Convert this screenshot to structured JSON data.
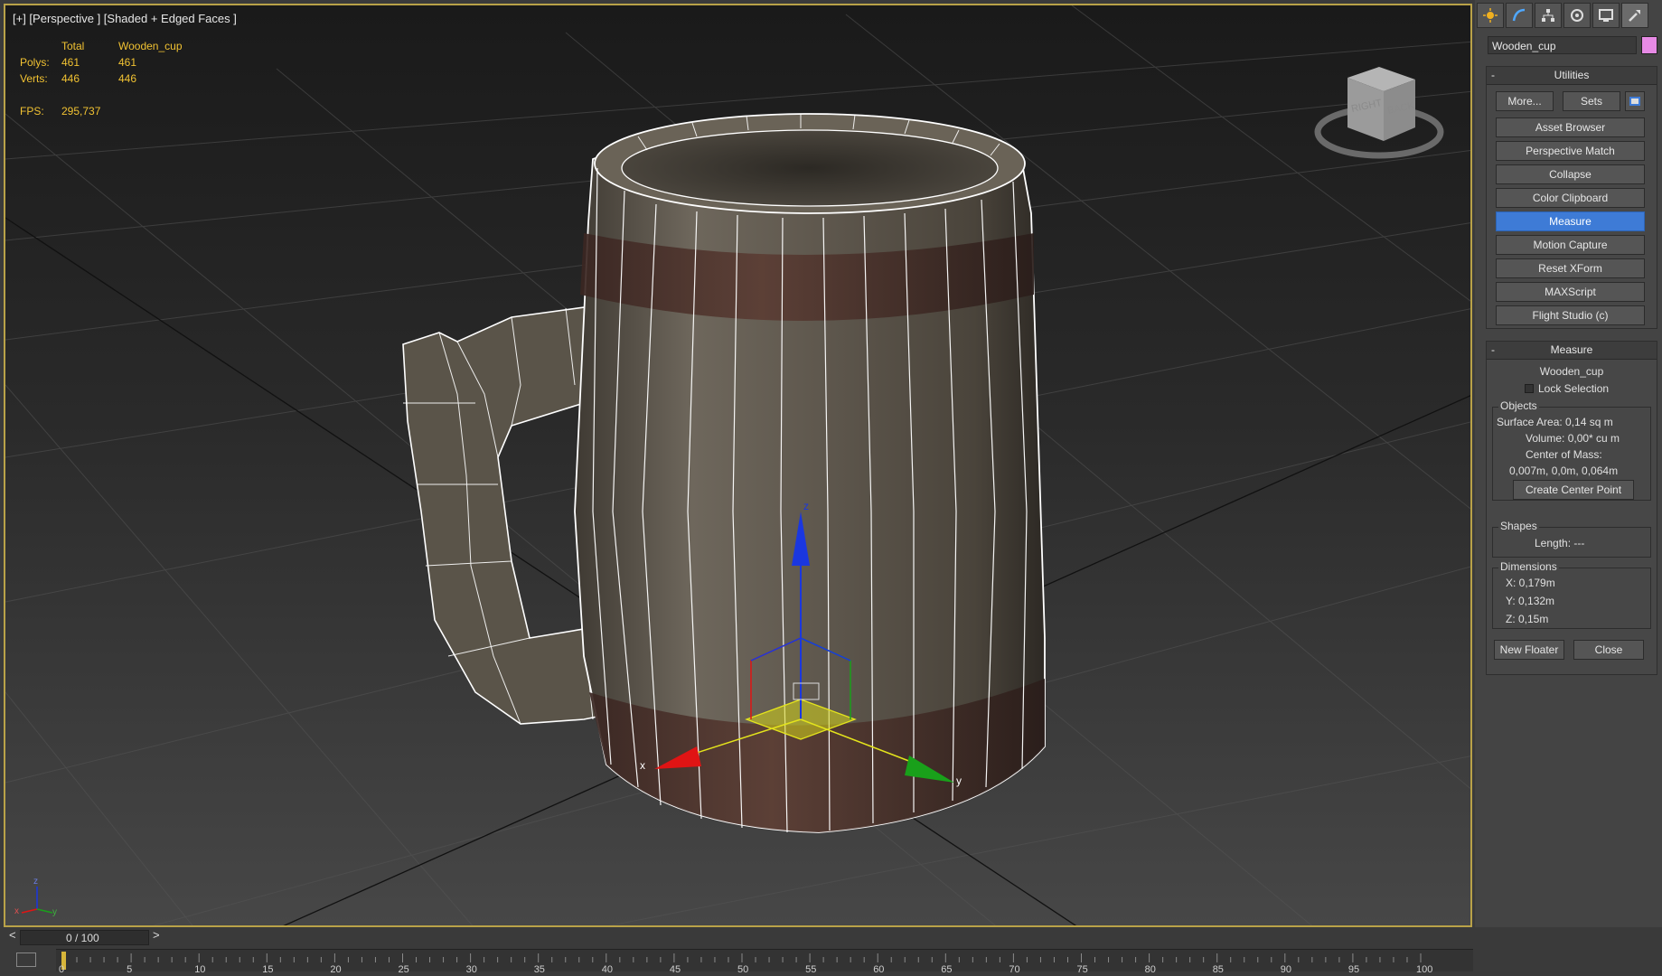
{
  "viewport": {
    "label": "[+] [Perspective ] [Shaded + Edged Faces ]",
    "stats": {
      "header_total": "Total",
      "header_object": "Wooden_cup",
      "polys_label": "Polys:",
      "polys_total": "461",
      "polys_object": "461",
      "verts_label": "Verts:",
      "verts_total": "446",
      "verts_object": "446",
      "fps_label": "FPS:",
      "fps_value": "295,737"
    },
    "view_cube": {
      "right": "RIGHT",
      "back": "BACK"
    },
    "axis_tripod": {
      "x": "x",
      "y": "y",
      "z": "z"
    },
    "gizmo": {
      "x": "x",
      "y": "y",
      "z": "z"
    }
  },
  "command_panel": {
    "tabs": [
      "create-tab",
      "modify-tab",
      "hierarchy-tab",
      "motion-tab",
      "display-tab",
      "utilities-tab"
    ],
    "object_name": "Wooden_cup",
    "object_color": "#e78ae5",
    "utilities": {
      "title": "Utilities",
      "more_label": "More...",
      "sets_label": "Sets",
      "items": [
        "Asset Browser",
        "Perspective Match",
        "Collapse",
        "Color Clipboard",
        "Measure",
        "Motion Capture",
        "Reset XForm",
        "MAXScript",
        "Flight Studio (c)"
      ],
      "active_item": "Measure"
    },
    "measure": {
      "title": "Measure",
      "object": "Wooden_cup",
      "lock_selection": "Lock Selection",
      "objects_group": "Objects",
      "surface_area": "Surface Area:  0,14 sq m",
      "volume": "Volume:  0,00* cu m",
      "center_of_mass": "Center of Mass:",
      "center_value": "0,007m, 0,0m, 0,064m",
      "create_center_point": "Create Center Point",
      "shapes_group": "Shapes",
      "length": "Length:  ---",
      "dimensions_group": "Dimensions",
      "dim_x": "X:   0,179m",
      "dim_y": "Y:   0,132m",
      "dim_z": "Z:   0,15m",
      "new_floater": "New Floater",
      "close": "Close"
    }
  },
  "timeline": {
    "slider_label": "0 / 100",
    "prev": "<",
    "next": ">",
    "ticks": [
      "0",
      "5",
      "10",
      "15",
      "20",
      "25",
      "30",
      "35",
      "40",
      "45",
      "50",
      "55",
      "60",
      "65",
      "70",
      "75",
      "80",
      "85",
      "90",
      "95",
      "100"
    ]
  },
  "colors": {
    "viewport_border": "#b9a248",
    "stats_text": "#f1c232",
    "active_button": "#3e7bd6",
    "gizmo_x": "#e01414",
    "gizmo_y": "#19a01a",
    "gizmo_z": "#1a37e0"
  }
}
